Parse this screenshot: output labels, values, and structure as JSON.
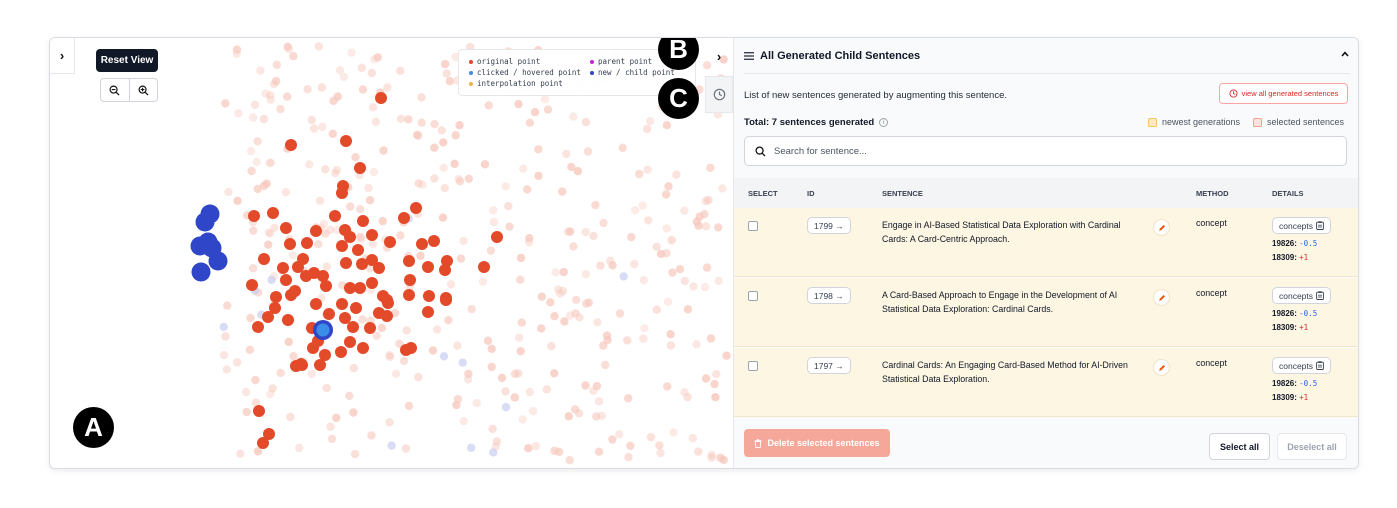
{
  "scatter": {
    "expand_label": "›",
    "reset_view_label": "Reset View",
    "legend": {
      "original": "original point",
      "clicked": "clicked / hovered point",
      "interpolation": "interpolation point",
      "parent": "parent point",
      "new_child": "new / child point"
    },
    "colors": {
      "original": "#e34a2a",
      "original_faded": "#f6c7bc",
      "clicked": "#3b8ee8",
      "interpolation": "#f5b342",
      "parent": "#c026d3",
      "new_child": "#2f46c9",
      "child_faded": "#c7cdf1"
    },
    "markers": {
      "a": "A",
      "b": "B",
      "c": "C"
    }
  },
  "sidebar": {
    "collapse_label": "›",
    "history_icon": "clock-icon"
  },
  "panel": {
    "title": "All Generated Child Sentences",
    "description": "List of new sentences generated by augmenting this sentence.",
    "view_all_label": "view all generated sentences",
    "total_label": "Total: 7 sentences generated",
    "info_glyph": "i",
    "legend_newest": "newest generations",
    "legend_selected": "selected sentences",
    "colors": {
      "newest": "#fde7b0",
      "selected": "#fecaca",
      "accent": "#dc2626"
    },
    "search_placeholder": "Search for sentence...",
    "columns": {
      "select": "SELECT",
      "id": "ID",
      "sentence": "SENTENCE",
      "method": "METHOD",
      "details": "DETAILS"
    },
    "rows": [
      {
        "id": "1799 →",
        "sentence": "Engage in AI-Based Statistical Data Exploration with Cardinal Cards: A Card-Centric Approach.",
        "method": "concept",
        "concepts_label": "concepts",
        "c1_key": "19826:",
        "c1_val": "-0.5",
        "c2_key": "18309:",
        "c2_val": "+1"
      },
      {
        "id": "1798 →",
        "sentence": "A Card-Based Approach to Engage in the Development of AI Statistical Data Exploration: Cardinal Cards.",
        "method": "concept",
        "concepts_label": "concepts",
        "c1_key": "19826:",
        "c1_val": "-0.5",
        "c2_key": "18309:",
        "c2_val": "+1"
      },
      {
        "id": "1797 →",
        "sentence": "Cardinal Cards: An Engaging Card-Based Method for AI-Driven Statistical Data Exploration.",
        "method": "concept",
        "concepts_label": "concepts",
        "c1_key": "19826:",
        "c1_val": "-0.5",
        "c2_key": "18309:",
        "c2_val": "+1"
      }
    ],
    "delete_label": "Delete selected sentences",
    "select_all_label": "Select all",
    "deselect_all_label": "Deselect all"
  }
}
